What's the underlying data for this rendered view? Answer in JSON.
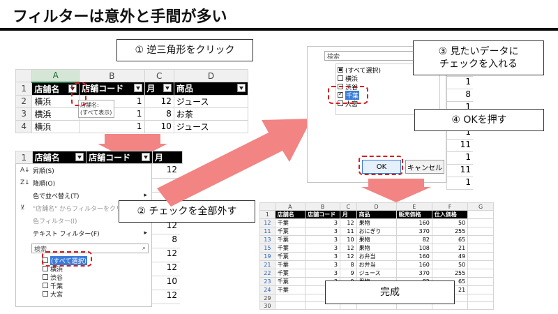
{
  "title": "フィルターは意外と手間が多い",
  "callouts": {
    "step1": "① 逆三角形をクリック",
    "step2": "② チェックを全部外す",
    "step3_l1": "③ 見たいデータに",
    "step3_l2": "チェックを入れる",
    "step4": "④ OKを押す",
    "done": "完成"
  },
  "sheet1": {
    "col_headers": [
      "A",
      "B",
      "C",
      "D"
    ],
    "header_row": [
      "店舗名",
      "店舗コード",
      "月",
      "商品"
    ],
    "rows": [
      {
        "n": "1"
      },
      {
        "n": "2",
        "a": "横浜",
        "b": "1",
        "c": "12",
        "d": "ジュース"
      },
      {
        "n": "3",
        "a": "横浜",
        "b": "1",
        "c": "8",
        "d": "お茶"
      },
      {
        "n": "4",
        "a": "横浜",
        "b": "1",
        "c": "10",
        "d": "ジュース"
      }
    ],
    "tooltip_l1": "店舗名:",
    "tooltip_l2": "(すべて表示)"
  },
  "menu": {
    "header_row": [
      "店舗名",
      "店舗コード",
      "月"
    ],
    "row_num": "1",
    "items": [
      "昇順(S)",
      "降順(O)",
      "色で並べ替え(T)",
      "\"店舗名\" からフィルターをクリア(C)",
      "色フィルター(I)",
      "テキスト フィルター(F)"
    ],
    "search_placeholder": "検索",
    "checks": [
      "(すべて選択)",
      "横浜",
      "渋谷",
      "千葉",
      "大宮"
    ],
    "side_values": [
      "12",
      "8",
      "10",
      "12",
      "12",
      "8",
      "12",
      "12",
      "10",
      "12"
    ]
  },
  "dialog": {
    "search_placeholder": "検索",
    "checks": [
      "(すべて選択)",
      "横浜",
      "渋谷",
      "千葉",
      "大宮"
    ],
    "ok": "OK",
    "cancel": "キャンセル",
    "side_values": [
      "1",
      "1",
      "8",
      "1",
      "8",
      "1",
      "11",
      "1",
      "11",
      "1"
    ]
  },
  "result": {
    "col_headers": [
      "A",
      "B",
      "C",
      "D",
      "E",
      "F",
      "G"
    ],
    "header_row": [
      "店舗名",
      "店舗コード",
      "月",
      "商品",
      "販売価格",
      "仕入価格"
    ],
    "rows": [
      {
        "n": "1"
      },
      {
        "n": "12",
        "a": "千葉",
        "b": "3",
        "c": "12",
        "d": "果物",
        "e": "160",
        "f": "50"
      },
      {
        "n": "11",
        "a": "千葉",
        "b": "3",
        "c": "11",
        "d": "おにぎり",
        "e": "370",
        "f": "255"
      },
      {
        "n": "13",
        "a": "千葉",
        "b": "3",
        "c": "10",
        "d": "果物",
        "e": "82",
        "f": "65"
      },
      {
        "n": "15",
        "a": "千葉",
        "b": "3",
        "c": "12",
        "d": "果物",
        "e": "108",
        "f": "21"
      },
      {
        "n": "19",
        "a": "千葉",
        "b": "3",
        "c": "12",
        "d": "お弁当",
        "e": "160",
        "f": "49"
      },
      {
        "n": "21",
        "a": "千葉",
        "b": "3",
        "c": "8",
        "d": "お弁当",
        "e": "160",
        "f": "50"
      },
      {
        "n": "22",
        "a": "千葉",
        "b": "3",
        "c": "9",
        "d": "ジュース",
        "e": "370",
        "f": "255"
      },
      {
        "n": "23",
        "a": "千葉",
        "b": "3",
        "c": "9",
        "d": "果物",
        "e": "82",
        "f": "65"
      },
      {
        "n": "24",
        "a": "千葉",
        "b": "3",
        "c": "",
        "d": "",
        "e": "",
        "f": "21"
      },
      {
        "n": "29"
      },
      {
        "n": "30"
      }
    ]
  }
}
